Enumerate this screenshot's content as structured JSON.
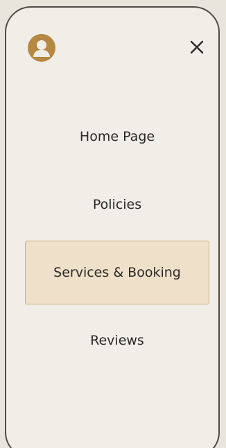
{
  "header": {
    "avatar_icon": "user-avatar-icon",
    "close_icon": "close-icon"
  },
  "menu": {
    "items": [
      {
        "label": "Home Page",
        "active": false
      },
      {
        "label": "Policies",
        "active": false
      },
      {
        "label": "Services & Booking",
        "active": true
      },
      {
        "label": "Reviews",
        "active": false
      }
    ]
  },
  "colors": {
    "accent": "#b58844",
    "active_bg": "#efe0c9",
    "active_border": "#cfb27e",
    "panel_bg": "#f1eee8"
  }
}
